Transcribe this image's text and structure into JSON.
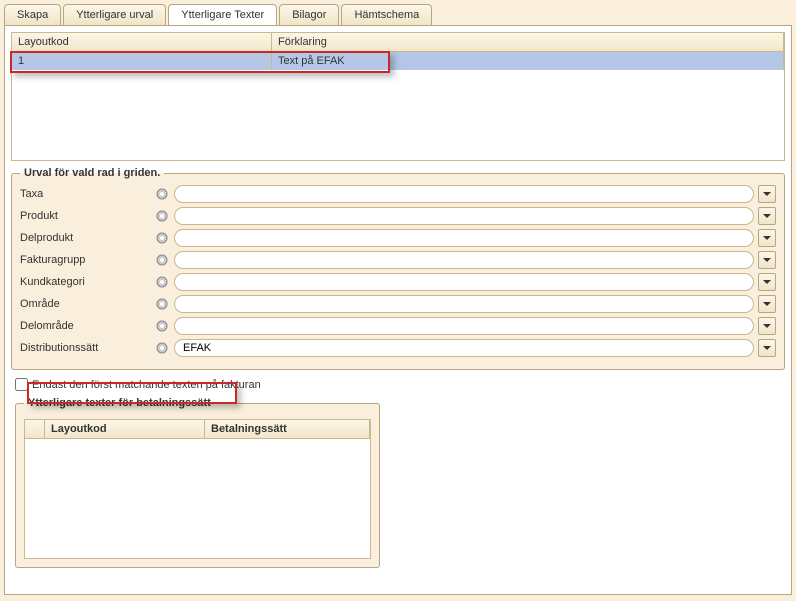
{
  "tabs": {
    "skapa": "Skapa",
    "ytterligare_urval": "Ytterligare urval",
    "ytterligare_texter": "Ytterligare Texter",
    "bilagor": "Bilagor",
    "hamtschema": "Hämtschema"
  },
  "grid": {
    "headers": {
      "layoutkod": "Layoutkod",
      "forklaring": "Förklaring"
    },
    "rows": [
      {
        "layoutkod": "1",
        "forklaring": "Text på EFAK"
      }
    ]
  },
  "urval": {
    "legend": "Urval för vald rad i griden.",
    "fields": {
      "taxa": {
        "label": "Taxa",
        "value": ""
      },
      "produkt": {
        "label": "Produkt",
        "value": ""
      },
      "delprodukt": {
        "label": "Delprodukt",
        "value": ""
      },
      "fakturagrupp": {
        "label": "Fakturagrupp",
        "value": ""
      },
      "kundkategori": {
        "label": "Kundkategori",
        "value": ""
      },
      "omrade": {
        "label": "Område",
        "value": ""
      },
      "delomrade": {
        "label": "Delområde",
        "value": ""
      },
      "distributionssatt": {
        "label": "Distributionssätt",
        "value": "EFAK"
      }
    }
  },
  "checkbox": {
    "label": "Endast den först matchande texten på fakturan",
    "checked": false
  },
  "betalningssatt": {
    "legend": "Ytterligare texter för betalningssätt",
    "headers": {
      "layoutkod": "Layoutkod",
      "betalningssatt": "Betalningssätt"
    }
  }
}
